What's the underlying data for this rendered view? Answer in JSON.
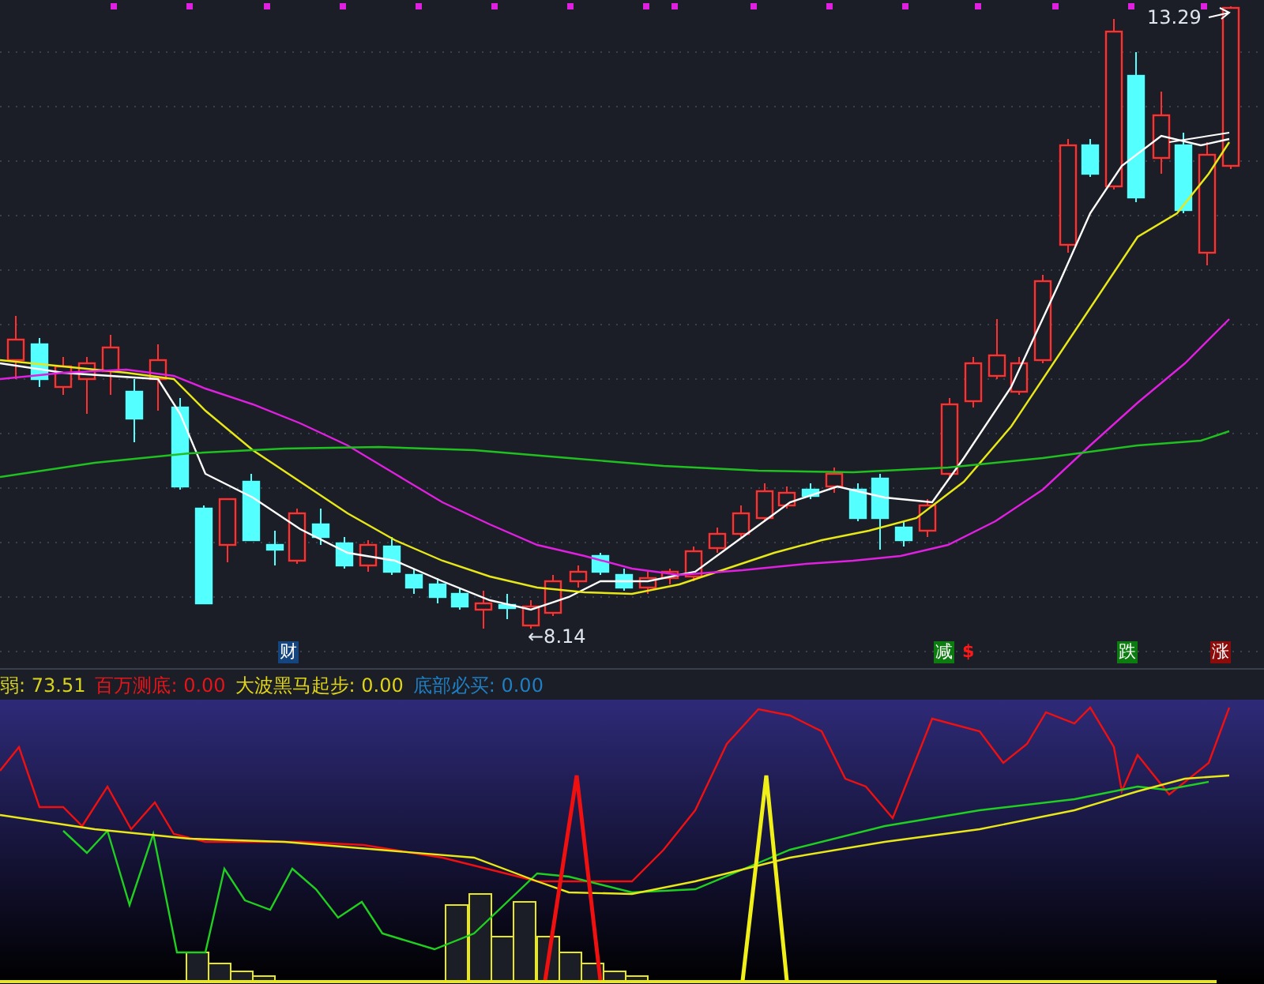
{
  "main_chart": {
    "high_label": "13.29",
    "low_label": "←8.14",
    "markers": [
      {
        "text": "财",
        "kind": "info"
      },
      {
        "text": "减",
        "kind": "reduce"
      },
      {
        "text": "$",
        "kind": "dollar"
      },
      {
        "text": "跌",
        "kind": "fall"
      },
      {
        "text": "涨",
        "kind": "rise"
      }
    ]
  },
  "indicator_bar": {
    "readings": [
      {
        "name": "弱:",
        "value": "73.51",
        "color": "#d6d21e"
      },
      {
        "name": "百万测底:",
        "value": "0.00",
        "color": "#e8141a"
      },
      {
        "name": "大波黑马起步:",
        "value": "0.00",
        "color": "#e0d418"
      },
      {
        "name": "底部必买:",
        "value": "0.00",
        "color": "#1f7fc4"
      }
    ]
  }
}
